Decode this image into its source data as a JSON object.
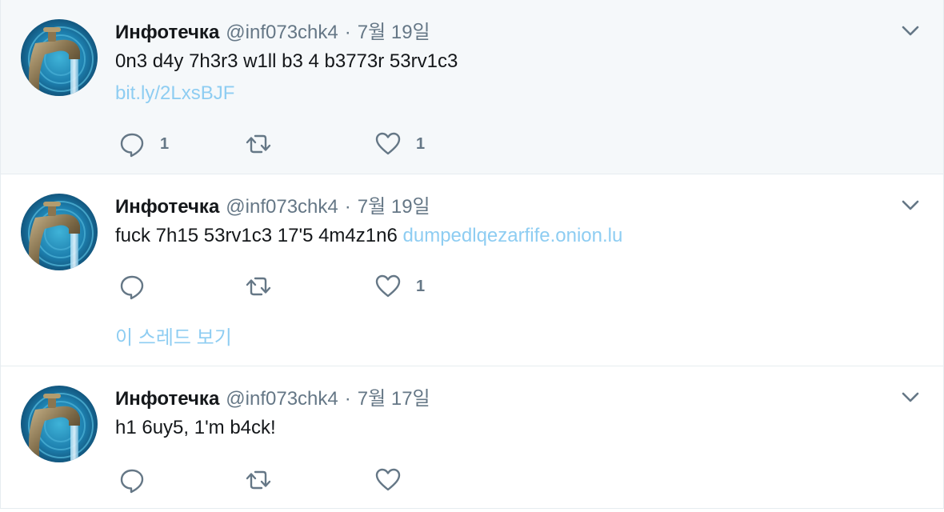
{
  "icons": {
    "reply": "reply-bubble-icon",
    "retweet": "retweet-arrows-icon",
    "like": "heart-outline-icon",
    "menu": "chevron-down-icon"
  },
  "colors": {
    "link": "#8ecdf2",
    "secondary_text": "#657786",
    "highlight_bg": "#f5f8fa",
    "border": "#e6ecf0"
  },
  "tweets": [
    {
      "name": "Инфотечка",
      "handle": "@inf073chk4",
      "separator": "·",
      "time": "7월 19일",
      "text": "0n3 d4y 7h3r3 w1ll b3 4 b3773r 53rv1c3",
      "link": "bit.ly/2LxsBJF",
      "replies": "1",
      "retweets": "",
      "likes": "1"
    },
    {
      "name": "Инфотечка",
      "handle": "@inf073chk4",
      "separator": "·",
      "time": "7월 19일",
      "text": "fuck 7h15 53rv1c3 17'5 4m4z1n6",
      "inline_link": "dumpedlqezarfife.onion.lu",
      "replies": "",
      "retweets": "",
      "likes": "1",
      "thread_label": "이 스레드 보기"
    },
    {
      "name": "Инфотечка",
      "handle": "@inf073chk4",
      "separator": "·",
      "time": "7월 17일",
      "text": "h1 6uy5, 1'm b4ck!",
      "replies": "",
      "retweets": "",
      "likes": ""
    }
  ]
}
